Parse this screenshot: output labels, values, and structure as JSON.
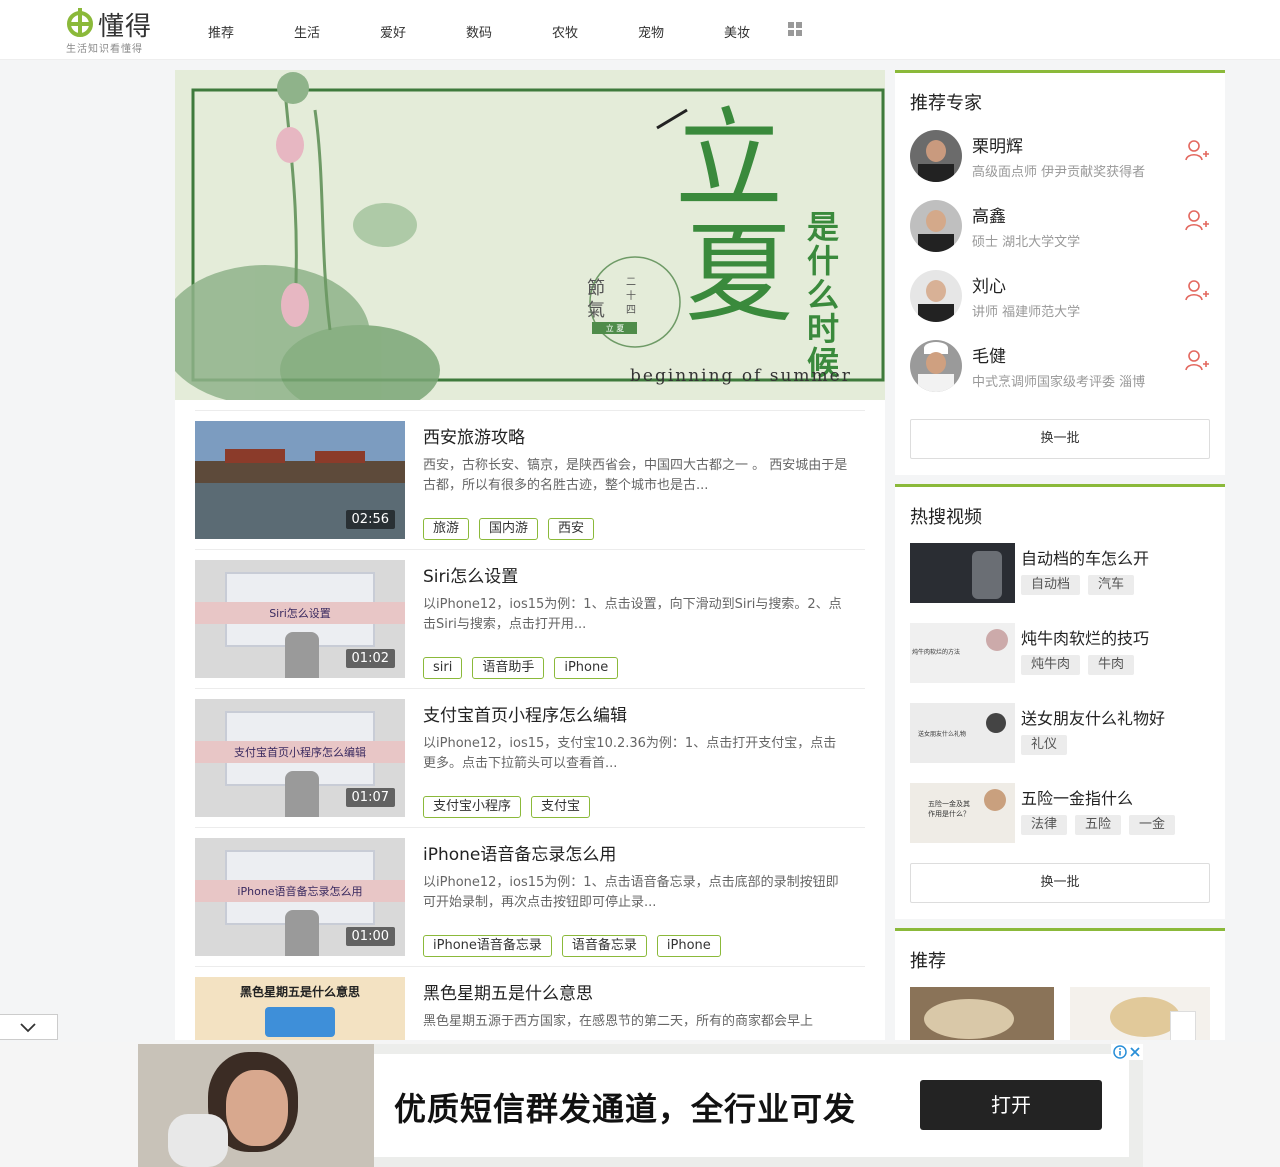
{
  "header": {
    "logo_title": "懂得",
    "logo_sub": "生活知识看懂得",
    "nav": [
      "推荐",
      "生活",
      "爱好",
      "数码",
      "农牧",
      "宠物",
      "美妆"
    ]
  },
  "banner": {
    "big1": "立",
    "big2": "夏",
    "side": "是什么时候",
    "seal1": "節",
    "seal2": "氣",
    "seal_small": "二十四",
    "seal_tag": "立 夏",
    "en": "beginning of summer"
  },
  "articles": [
    {
      "title": "西安旅游攻略",
      "desc": "西安，古称长安、镐京，是陕西省会，中国四大古都之一 。 西安城由于是古都，所以有很多的名胜古迹，整个城市也是古...",
      "duration": "02:56",
      "tags": [
        "旅游",
        "国内游",
        "西安"
      ],
      "thumb_text": ""
    },
    {
      "title": "Siri怎么设置",
      "desc": "以iPhone12，ios15为例：1、点击设置，向下滑动到Siri与搜索。2、点击Siri与搜索，点击打开用...",
      "duration": "01:02",
      "tags": [
        "siri",
        "语音助手",
        "iPhone"
      ],
      "thumb_text": "Siri怎么设置"
    },
    {
      "title": "支付宝首页小程序怎么编辑",
      "desc": "以iPhone12，ios15，支付宝10.2.36为例：1、点击打开支付宝，点击更多。点击下拉箭头可以查看首...",
      "duration": "01:07",
      "tags": [
        "支付宝小程序",
        "支付宝"
      ],
      "thumb_text": "支付宝首页小程序怎么编辑"
    },
    {
      "title": "iPhone语音备忘录怎么用",
      "desc": "以iPhone12，ios15为例：1、点击语音备忘录，点击底部的录制按钮即可开始录制，再次点击按钮即可停止录...",
      "duration": "01:00",
      "tags": [
        "iPhone语音备忘录",
        "语音备忘录",
        "iPhone"
      ],
      "thumb_text": "iPhone语音备忘录怎么用"
    },
    {
      "title": "黑色星期五是什么意思",
      "desc": "黑色星期五源于西方国家，在感恩节的第二天，所有的商家都会早上",
      "duration": "",
      "tags": [],
      "thumb_text": "黑色星期五是什么意思"
    }
  ],
  "experts": {
    "title": "推荐专家",
    "items": [
      {
        "name": "栗明辉",
        "desc": "高级面点师 伊尹贡献奖获得者"
      },
      {
        "name": "高鑫",
        "desc": "硕士 湖北大学文学"
      },
      {
        "name": "刘心",
        "desc": "讲师 福建师范大学"
      },
      {
        "name": "毛健",
        "desc": "中式烹调师国家级考评委 淄博"
      }
    ],
    "more": "换一批"
  },
  "hot": {
    "title": "热搜视频",
    "items": [
      {
        "title": "自动档的车怎么开",
        "tags": [
          "自动档",
          "汽车"
        ],
        "thumb_text": ""
      },
      {
        "title": "炖牛肉软烂的技巧",
        "tags": [
          "炖牛肉",
          "牛肉"
        ],
        "thumb_text": "炖牛肉软烂的方法"
      },
      {
        "title": "送女朋友什么礼物好",
        "tags": [
          "礼仪"
        ],
        "thumb_text": "送女朋友什么礼物"
      },
      {
        "title": "五险一金指什么",
        "tags": [
          "法律",
          "五险",
          "一金"
        ],
        "thumb_text": "五险一金及其作用是什么？"
      }
    ],
    "more": "换一批"
  },
  "recommend": {
    "title": "推荐"
  },
  "ad": {
    "text": "优质短信群发通道，全行业可发",
    "button": "打开"
  }
}
